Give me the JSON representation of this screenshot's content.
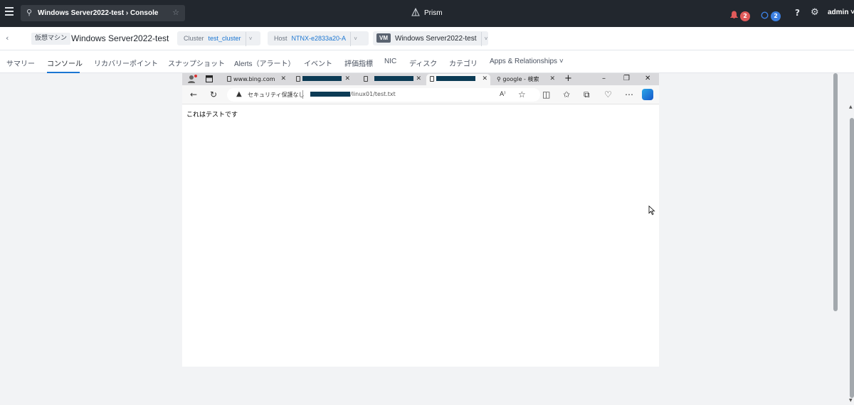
{
  "topbar": {
    "search_text": "Windows Server2022-test › Console",
    "app_name": "Prism",
    "alerts_count": "2",
    "tasks_count": "2",
    "help": "?",
    "user": "admin ˅"
  },
  "breadcrumb": {
    "vm_type_label": "仮想マシン",
    "vm_name": "Windows Server2022-test",
    "cluster_label": "Cluster",
    "cluster_value": "test_cluster",
    "host_label": "Host",
    "host_value": "NTNX-e2833a20-A",
    "vm_tag": "VM",
    "vm_value": "Windows Server2022-test"
  },
  "tabs": [
    {
      "label": "サマリー"
    },
    {
      "label": "コンソール"
    },
    {
      "label": "リカバリーポイント"
    },
    {
      "label": "スナップショット"
    },
    {
      "label": "Alerts（アラート）"
    },
    {
      "label": "イベント"
    },
    {
      "label": "評価指標"
    },
    {
      "label": "NIC"
    },
    {
      "label": "ディスク"
    },
    {
      "label": "カテゴリ"
    },
    {
      "label": "Apps & Relationships ˅"
    }
  ],
  "remote_browser": {
    "tabs": [
      {
        "label": "www.bing.com"
      },
      {
        "label": ""
      },
      {
        "label": ""
      },
      {
        "label": ""
      },
      {
        "label": "google - 検索"
      }
    ],
    "new_tab": "+",
    "security_label": "セキュリティ保護なし",
    "url_suffix": "/linux01/test.txt",
    "page_text": "これはテストです"
  }
}
